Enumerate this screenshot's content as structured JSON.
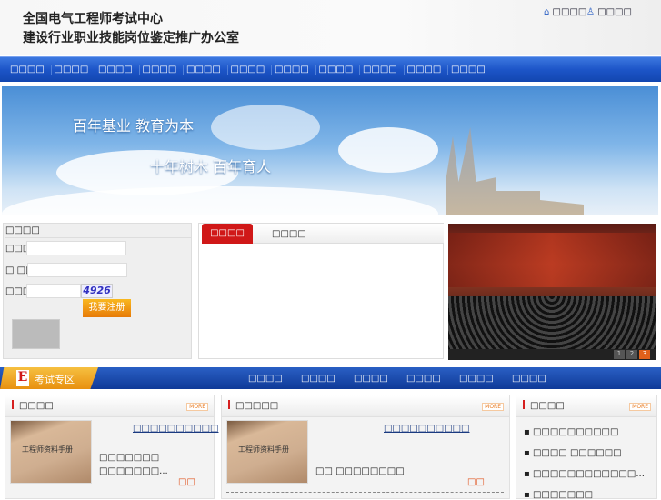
{
  "header": {
    "title_line1": "全国电气工程师考试中心",
    "title_line2": "建设行业职业技能岗位鉴定推广办公室",
    "home_link": "□□□□",
    "fav_link": "□□□□"
  },
  "nav": [
    "□□□□",
    "□□□□",
    "□□□□",
    "□□□□",
    "□□□□",
    "□□□□",
    "□□□□",
    "□□□□",
    "□□□□",
    "□□□□",
    "□□□□"
  ],
  "banner": {
    "slogan1": "百年基业  教育为本",
    "slogan2": "十年树木  百年育人"
  },
  "login": {
    "title": "□□□□",
    "username_label": "□□□□",
    "password_label": "□  □□",
    "captcha_label": "□□□□",
    "captcha_value": "4926",
    "register_button": "我要注册"
  },
  "tabs": {
    "active": "□□□□",
    "other": "□□□□"
  },
  "photo": {
    "pager": [
      "1",
      "2",
      "3"
    ]
  },
  "exam": {
    "label": "考试专区",
    "items": [
      "□□□□",
      "□□□□",
      "□□□□",
      "□□□□",
      "□□□□",
      "□□□□"
    ]
  },
  "col1": {
    "title": "□□□□",
    "more": "MORE",
    "thumb_text": "工程师资料手册",
    "link": "□□□□□□□□□□",
    "line1": "□□□□□□□",
    "line2": "□□□□□□□...",
    "detail": "□□"
  },
  "col2": {
    "title": "□□□□□",
    "more": "MORE",
    "thumb_text": "工程师资料手册",
    "link": "□□□□□□□□□□",
    "line1": "□□ □□□□□□□□",
    "detail": "□□"
  },
  "col3": {
    "title": "□□□□",
    "more": "MORE",
    "items": [
      "□□□□□□□□□□",
      "□□□□ □□□□□□",
      "□□□□□□□□□□□□...",
      "□□□□□□□"
    ]
  }
}
